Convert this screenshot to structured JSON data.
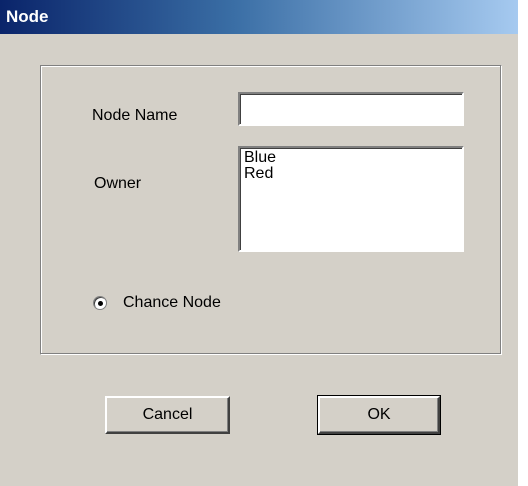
{
  "window": {
    "title": "Node"
  },
  "form": {
    "node_name_label": "Node Name",
    "node_name_value": "",
    "owner_label": "Owner",
    "owner_options": [
      "Blue",
      "Red"
    ],
    "chance_node_label": "Chance Node",
    "chance_node_selected": true
  },
  "buttons": {
    "cancel_label": "Cancel",
    "ok_label": "OK"
  },
  "colors": {
    "dialog_background": "#d4d0c8",
    "title_gradient_start": "#0a246a",
    "title_gradient_end": "#a6caf0",
    "title_text": "#ffffff"
  }
}
